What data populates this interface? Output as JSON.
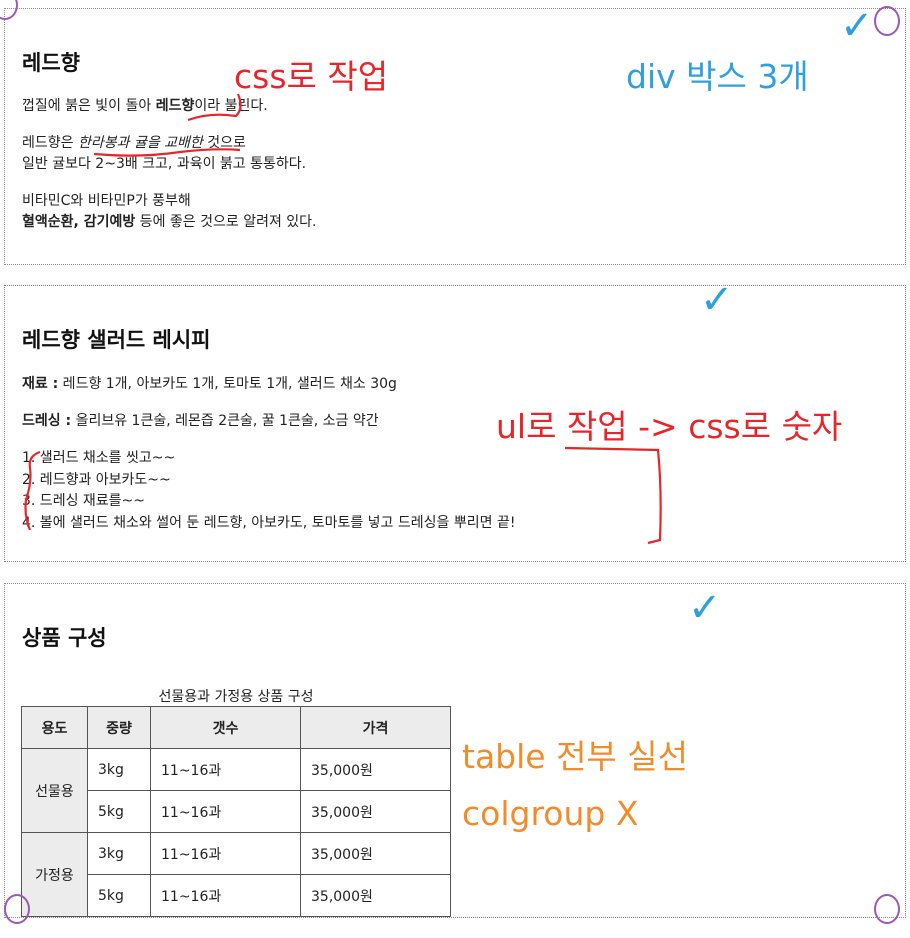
{
  "intro": {
    "title": "레드향",
    "p1": {
      "before": "껍질에 붉은 빛이 돌아 ",
      "strong": "레드향",
      "after": "이라 불린다."
    },
    "p2": {
      "before": "레드향은 ",
      "em": "한라봉과 귤을 교배한",
      "after": " 것으로",
      "line2": "일반 귤보다 2~3배 크고, 과육이 붉고 통통하다."
    },
    "p3": {
      "line1": "비타민C와 비타민P가 풍부해",
      "strong": "혈액순환, 감기예방",
      "after": " 등에 좋은 것으로 알려져 있다."
    }
  },
  "recipe": {
    "title": "레드향 샐러드 레시피",
    "ingredients_label": "재료 :",
    "ingredients": " 레드향 1개, 아보카도 1개, 토마토 1개, 샐러드 채소 30g",
    "dressing_label": "드레싱 :",
    "dressing": " 올리브유 1큰술, 레몬즙 2큰술, 꿀 1큰술, 소금 약간",
    "steps": [
      "1. 샐러드 채소를 씻고~~",
      "2. 레드향과 아보카도~~",
      "3. 드레싱 재료를~~",
      "4. 볼에 샐러드 채소와 썰어 둔 레드향, 아보카도, 토마토를 넣고 드레싱을 뿌리면 끝!"
    ]
  },
  "products": {
    "title": "상품 구성",
    "caption": "선물용과 가정용 상품 구성",
    "headers": [
      "용도",
      "중량",
      "갯수",
      "가격"
    ],
    "groups": [
      {
        "usage": "선물용",
        "rows": [
          [
            "3kg",
            "11~16과",
            "35,000원"
          ],
          [
            "5kg",
            "11~16과",
            "35,000원"
          ]
        ]
      },
      {
        "usage": "가정용",
        "rows": [
          [
            "3kg",
            "11~16과",
            "35,000원"
          ],
          [
            "5kg",
            "11~16과",
            "35,000원"
          ]
        ]
      }
    ]
  },
  "annotations": {
    "css_note": "css로 작업",
    "div_note": "div 박스 3개",
    "ul_note": "ul로 작업 -> css로 숫자",
    "table_note": "table 전부 실선",
    "colgroup_note": "colgroup X",
    "check": "✓"
  },
  "colors": {
    "red_ink": "#e8262a",
    "blue_ink": "#2f9fdd",
    "orange_ink": "#f28c2a",
    "purple_ink": "#9b59b6",
    "table_header_bg": "#ececec"
  }
}
